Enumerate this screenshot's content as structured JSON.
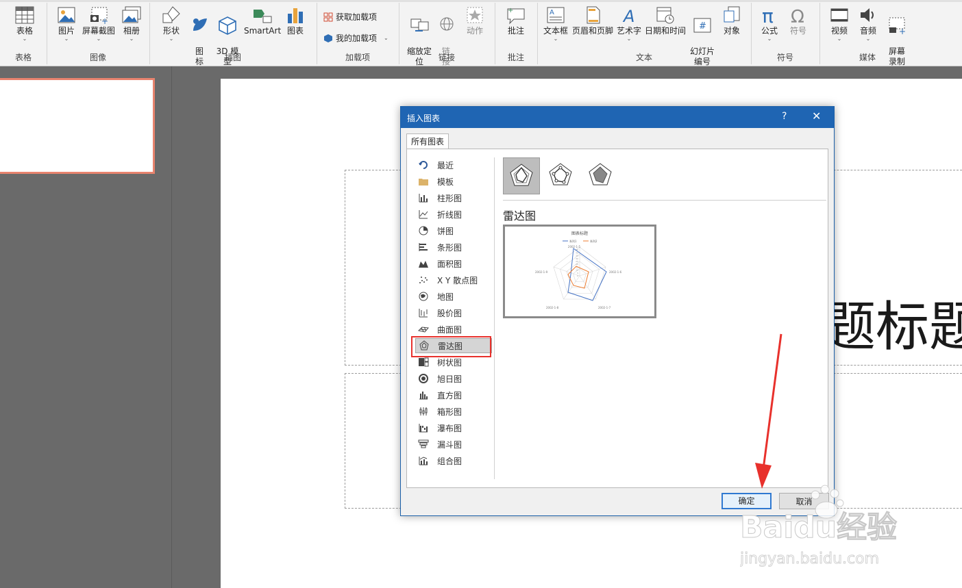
{
  "ribbon": {
    "groups": [
      {
        "label": "表格"
      },
      {
        "label": "图像"
      },
      {
        "label": "插图"
      },
      {
        "label": "加载项"
      },
      {
        "label": "链接"
      },
      {
        "label": "批注"
      },
      {
        "label": "文本"
      },
      {
        "label": "符号"
      },
      {
        "label": "媒体"
      }
    ],
    "buttons": {
      "table": "表格",
      "picture": "图片",
      "screenshot": "屏幕截图",
      "album": "相册",
      "shapes": "形状",
      "icons": "图\n标",
      "model3d": "3D 模\n型",
      "smartart": "SmartArt",
      "chart": "图表",
      "get_addins": "获取加载项",
      "my_addins": "我的加载项",
      "zoom": "缩放定\n位",
      "link": "链\n接",
      "action": "动作",
      "comment": "批注",
      "textbox": "文本框",
      "header_footer": "页眉和页脚",
      "wordart": "艺术字",
      "datetime": "日期和时间",
      "slide_number": "幻灯片\n编号",
      "object": "对象",
      "equation": "公式",
      "symbol": "符号",
      "video": "视频",
      "audio": "音频",
      "screen_record": "屏幕\n录制"
    }
  },
  "slide": {
    "title_fragment": "题标题"
  },
  "dialog": {
    "title": "插入图表",
    "help": "?",
    "close": "✕",
    "tab": "所有图表",
    "categories": [
      "最近",
      "模板",
      "柱形图",
      "折线图",
      "饼图",
      "条形图",
      "面积图",
      "X Y 散点图",
      "地图",
      "股价图",
      "曲面图",
      "雷达图",
      "树状图",
      "旭日图",
      "直方图",
      "箱形图",
      "瀑布图",
      "漏斗图",
      "组合图"
    ],
    "selected_category": "雷达图",
    "subtype_title": "雷达图",
    "preview": {
      "chart_title": "图表标题",
      "legend": [
        "系列1",
        "系列2"
      ],
      "axis_labels": [
        "2002-1-5",
        "2002-1-6",
        "2002-1-7",
        "2002-1-8",
        "2002-1-9"
      ],
      "ticks": [
        "0",
        "5",
        "10",
        "15",
        "20",
        "25",
        "30",
        "35",
        "40",
        "45"
      ]
    },
    "ok": "确定",
    "cancel": "取消"
  },
  "watermark": {
    "brand": "Baidu经验",
    "url": "jingyan.baidu.com"
  },
  "colors": {
    "dialog_title_bar": "#1f65b3",
    "highlight_box": "#e8312c",
    "thumb_border": "#e8836e",
    "series1": "#4472c4",
    "series2": "#ed7d31"
  }
}
